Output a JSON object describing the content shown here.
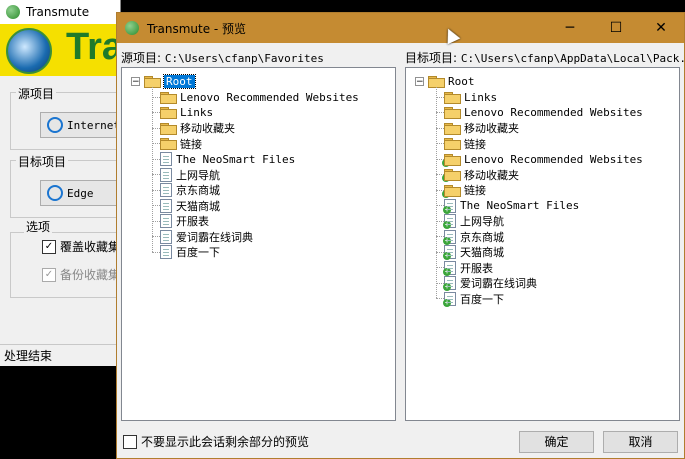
{
  "background_window": {
    "title": "Transmute",
    "banner_text": "Tra",
    "source_group": "源项目",
    "source_button": "Internet",
    "target_group": "目标项目",
    "target_button": "Edge",
    "options_group": "选项",
    "option_overwrite": "覆盖收藏集",
    "option_backup": "备份收藏集",
    "status": "处理结束"
  },
  "dialog": {
    "title": "Transmute - 预览",
    "window_buttons": {
      "minimize": "─",
      "maximize": "☐",
      "close": "✕"
    },
    "source": {
      "label": "源项目:",
      "path": "C:\\Users\\cfanp\\Favorites",
      "root": "Root",
      "items": [
        {
          "type": "folder",
          "label": "Lenovo Recommended Websites"
        },
        {
          "type": "folder",
          "label": "Links"
        },
        {
          "type": "folder",
          "label": "移动收藏夹"
        },
        {
          "type": "folder",
          "label": "链接"
        },
        {
          "type": "page",
          "label": "The NeoSmart Files"
        },
        {
          "type": "page",
          "label": "上网导航"
        },
        {
          "type": "page",
          "label": "京东商城"
        },
        {
          "type": "page",
          "label": "天猫商城"
        },
        {
          "type": "page",
          "label": "开服表"
        },
        {
          "type": "page",
          "label": "爱词霸在线词典"
        },
        {
          "type": "page",
          "label": "百度一下"
        }
      ]
    },
    "target": {
      "label": "目标项目:",
      "path": "C:\\Users\\cfanp\\AppData\\Local\\Pack...",
      "root": "Root",
      "items": [
        {
          "type": "folder",
          "label": "Links",
          "added": false
        },
        {
          "type": "folder",
          "label": "Lenovo Recommended Websites",
          "added": false
        },
        {
          "type": "folder",
          "label": "移动收藏夹",
          "added": false
        },
        {
          "type": "folder",
          "label": "链接",
          "added": false
        },
        {
          "type": "folder",
          "label": "Lenovo Recommended Websites",
          "added": true
        },
        {
          "type": "folder",
          "label": "移动收藏夹",
          "added": true
        },
        {
          "type": "folder",
          "label": "链接",
          "added": true
        },
        {
          "type": "page",
          "label": "The NeoSmart Files",
          "added": true
        },
        {
          "type": "page",
          "label": "上网导航",
          "added": true
        },
        {
          "type": "page",
          "label": "京东商城",
          "added": true
        },
        {
          "type": "page",
          "label": "天猫商城",
          "added": true
        },
        {
          "type": "page",
          "label": "开服表",
          "added": true
        },
        {
          "type": "page",
          "label": "爱词霸在线词典",
          "added": true
        },
        {
          "type": "page",
          "label": "百度一下",
          "added": true
        }
      ]
    },
    "dont_show_label": "不要显示此会话剩余部分的预览",
    "ok_button": "确定",
    "cancel_button": "取消"
  }
}
